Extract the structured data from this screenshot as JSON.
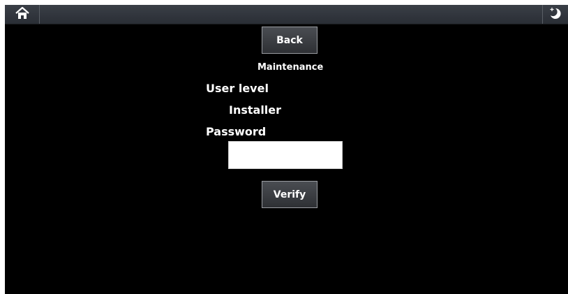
{
  "header": {
    "home_icon": "home-icon",
    "night_mode_icon": "night-mode-icon"
  },
  "main": {
    "back_label": "Back",
    "title": "Maintenance",
    "user_level_label": "User level",
    "user_level_value": "Installer",
    "password_label": "Password",
    "password_value": "",
    "verify_label": "Verify"
  },
  "colors": {
    "background": "#000000",
    "topbar": "#2e3238",
    "text": "#ffffff"
  }
}
